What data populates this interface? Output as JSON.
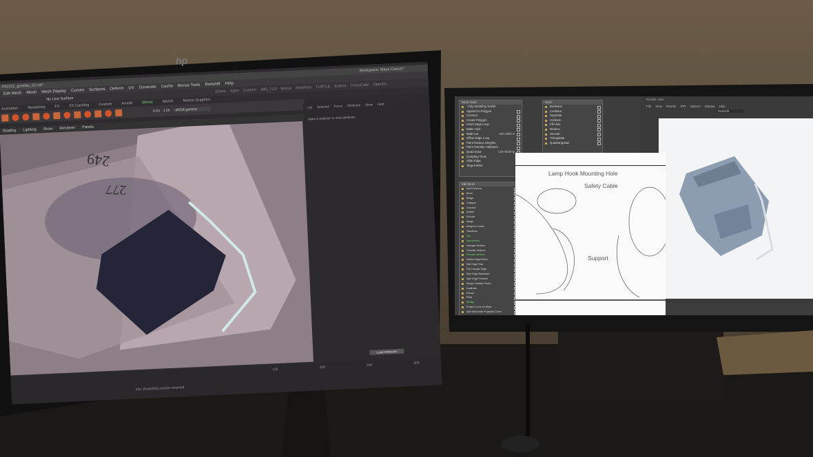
{
  "left_monitor": {
    "brand": "hp",
    "title": "P02152_greeble_03.mb*",
    "workspace": "Workspace: Maya Classic*",
    "menu": [
      "Edit Mesh",
      "Mesh",
      "Mesh Display",
      "Curves",
      "Surfaces",
      "Deform",
      "UV",
      "Generate",
      "Cache",
      "Bonus Tools",
      "Redshift",
      "Help"
    ],
    "status": {
      "live_surface": "No Live Surface",
      "tabs": [
        "Shane",
        "Xgen",
        "Custom",
        "JBR_TLD",
        "Bonus",
        "RealFlow",
        "TURTLE",
        "Extend",
        "CrossCase",
        "OpenGL"
      ]
    },
    "shelf_tabs": [
      "Animation",
      "Rendering",
      "FX",
      "FX Caching",
      "Custom",
      "Arnold",
      "Bifrost",
      "MASH",
      "Motion Graphics"
    ],
    "panel_menu": [
      "Shading",
      "Lighting",
      "Show",
      "Renderer",
      "Panels"
    ],
    "viewport": {
      "exposure": "0.00",
      "gamma": "1.00",
      "color_space": "sRGB gamma",
      "numbers": [
        "249",
        "277"
      ]
    },
    "attribute_editor": {
      "tabs": [
        "List",
        "Selected",
        "Focus",
        "Attributes",
        "Show",
        "Help"
      ],
      "message": "Make a selection to view attributes"
    },
    "timeline": {
      "ticks": [
        "120",
        "200",
        "250",
        "300"
      ],
      "button": "Load Attributes"
    },
    "help_line": "Info: [Redshift] License returned"
  },
  "right_monitor": {
    "mesh_tools": {
      "title": "Mesh Tools",
      "header": "Poly Modeling Toolkit",
      "items": [
        {
          "label": "Append to Polygon"
        },
        {
          "label": "Connect"
        },
        {
          "label": "Create Polygon"
        },
        {
          "label": "Insert Edge Loop"
        },
        {
          "label": "Make Hole"
        },
        {
          "label": "Multi-Cut",
          "shortcut": "Ctrl+Shift+X"
        },
        {
          "label": "Offset Edge Loop"
        },
        {
          "label": "Paint Reduce Weights"
        },
        {
          "label": "Paint Transfer Attributes"
        },
        {
          "label": "Quad Draw",
          "shortcut": "Ctrl+Shift+Q"
        },
        {
          "label": "Sculpting Tools"
        },
        {
          "label": "Slide Edge"
        },
        {
          "label": "Target Weld"
        }
      ]
    },
    "mesh": {
      "title": "Mesh",
      "items": [
        "Booleans",
        "Combine",
        "Separate",
        "Conform",
        "Fill Hole",
        "Reduce",
        "Smooth",
        "Triangulate",
        "Quadrangulate"
      ]
    },
    "edit_mesh": {
      "title": "Edit Mesh",
      "items": [
        {
          "label": "Add Divisions"
        },
        {
          "label": "Bevel"
        },
        {
          "label": "Bridge"
        },
        {
          "label": "Collapse"
        },
        {
          "label": "Connect"
        },
        {
          "label": "Detach"
        },
        {
          "label": "Extrude"
        },
        {
          "label": "Merge"
        },
        {
          "label": "Merge to Center"
        },
        {
          "label": "Transform"
        },
        {
          "label": "Flip",
          "highlight": true
        },
        {
          "label": "Symmetrize",
          "highlight": true
        },
        {
          "label": "Average Vertices"
        },
        {
          "label": "Chamfer Vertices"
        },
        {
          "label": "Reorder Vertices",
          "highlight": true
        },
        {
          "label": "Delete Edge/Vertex"
        },
        {
          "label": "Edit Edge Flow"
        },
        {
          "label": "Flip Triangle Edge"
        },
        {
          "label": "Spin Edge Backward"
        },
        {
          "label": "Spin Edge Forward"
        },
        {
          "label": "Assign Invisible Faces"
        },
        {
          "label": "Duplicate"
        },
        {
          "label": "Extract"
        },
        {
          "label": "Poke"
        },
        {
          "label": "Wedge",
          "highlight": true
        },
        {
          "label": "Project Curve on Mesh"
        },
        {
          "label": "Split Mesh with Projected Curve"
        }
      ]
    },
    "document": {
      "labels": [
        "Lamp Hook Mounting Hole",
        "Safety Cable",
        "Support"
      ]
    },
    "render_view": {
      "title": "Render View",
      "menu": [
        "File",
        "View",
        "Render",
        "IPR",
        "Options",
        "Display",
        "Help"
      ],
      "renderer": "Redshift"
    }
  },
  "colors": {
    "wall": "#5a4e3e",
    "maya_ui": "#3b393b",
    "viewport": "#8a7b82",
    "render_bg": "#f3f4f6",
    "model": "#8a9bb0",
    "highlight": "#6fdc6f"
  }
}
